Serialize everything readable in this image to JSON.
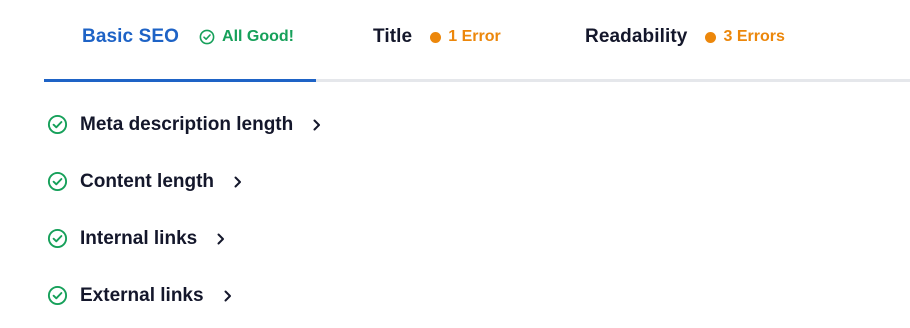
{
  "tabs": [
    {
      "label": "Basic SEO",
      "status": "All Good!",
      "status_type": "good",
      "status_icon": "check-circle-icon"
    },
    {
      "label": "Title",
      "status": "1 Error",
      "status_type": "warning",
      "status_icon": "orange-dot-icon"
    },
    {
      "label": "Readability",
      "status": "3 Errors",
      "status_type": "warning",
      "status_icon": "orange-dot-icon"
    }
  ],
  "active_tab": "Basic SEO",
  "checks": [
    {
      "label": "Meta description length",
      "icon": "check-circle-icon",
      "expand_icon": "chevron-right-icon"
    },
    {
      "label": "Content length",
      "icon": "check-circle-icon",
      "expand_icon": "chevron-right-icon"
    },
    {
      "label": "Internal links",
      "icon": "check-circle-icon",
      "expand_icon": "chevron-right-icon"
    },
    {
      "label": "External links",
      "icon": "check-circle-icon",
      "expand_icon": "chevron-right-icon"
    }
  ],
  "colors": {
    "active": "#1e63c6",
    "good": "#16a05a",
    "warning": "#ec870b",
    "text": "#14172b",
    "divider": "#e5e7eb"
  }
}
